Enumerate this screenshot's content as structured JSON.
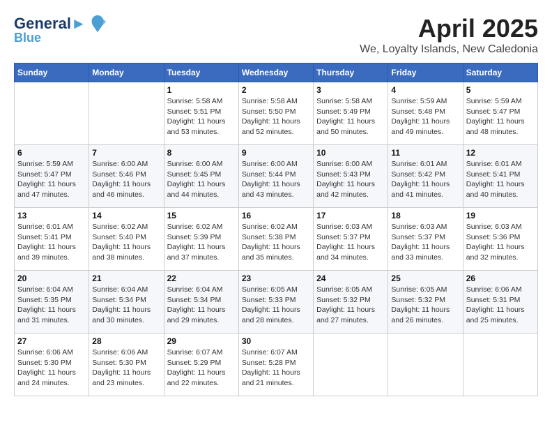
{
  "header": {
    "logo_line1": "General",
    "logo_line2": "Blue",
    "month_year": "April 2025",
    "location": "We, Loyalty Islands, New Caledonia"
  },
  "weekdays": [
    "Sunday",
    "Monday",
    "Tuesday",
    "Wednesday",
    "Thursday",
    "Friday",
    "Saturday"
  ],
  "weeks": [
    [
      {
        "day": "",
        "info": ""
      },
      {
        "day": "",
        "info": ""
      },
      {
        "day": "1",
        "info": "Sunrise: 5:58 AM\nSunset: 5:51 PM\nDaylight: 11 hours and 53 minutes."
      },
      {
        "day": "2",
        "info": "Sunrise: 5:58 AM\nSunset: 5:50 PM\nDaylight: 11 hours and 52 minutes."
      },
      {
        "day": "3",
        "info": "Sunrise: 5:58 AM\nSunset: 5:49 PM\nDaylight: 11 hours and 50 minutes."
      },
      {
        "day": "4",
        "info": "Sunrise: 5:59 AM\nSunset: 5:48 PM\nDaylight: 11 hours and 49 minutes."
      },
      {
        "day": "5",
        "info": "Sunrise: 5:59 AM\nSunset: 5:47 PM\nDaylight: 11 hours and 48 minutes."
      }
    ],
    [
      {
        "day": "6",
        "info": "Sunrise: 5:59 AM\nSunset: 5:47 PM\nDaylight: 11 hours and 47 minutes."
      },
      {
        "day": "7",
        "info": "Sunrise: 6:00 AM\nSunset: 5:46 PM\nDaylight: 11 hours and 46 minutes."
      },
      {
        "day": "8",
        "info": "Sunrise: 6:00 AM\nSunset: 5:45 PM\nDaylight: 11 hours and 44 minutes."
      },
      {
        "day": "9",
        "info": "Sunrise: 6:00 AM\nSunset: 5:44 PM\nDaylight: 11 hours and 43 minutes."
      },
      {
        "day": "10",
        "info": "Sunrise: 6:00 AM\nSunset: 5:43 PM\nDaylight: 11 hours and 42 minutes."
      },
      {
        "day": "11",
        "info": "Sunrise: 6:01 AM\nSunset: 5:42 PM\nDaylight: 11 hours and 41 minutes."
      },
      {
        "day": "12",
        "info": "Sunrise: 6:01 AM\nSunset: 5:41 PM\nDaylight: 11 hours and 40 minutes."
      }
    ],
    [
      {
        "day": "13",
        "info": "Sunrise: 6:01 AM\nSunset: 5:41 PM\nDaylight: 11 hours and 39 minutes."
      },
      {
        "day": "14",
        "info": "Sunrise: 6:02 AM\nSunset: 5:40 PM\nDaylight: 11 hours and 38 minutes."
      },
      {
        "day": "15",
        "info": "Sunrise: 6:02 AM\nSunset: 5:39 PM\nDaylight: 11 hours and 37 minutes."
      },
      {
        "day": "16",
        "info": "Sunrise: 6:02 AM\nSunset: 5:38 PM\nDaylight: 11 hours and 35 minutes."
      },
      {
        "day": "17",
        "info": "Sunrise: 6:03 AM\nSunset: 5:37 PM\nDaylight: 11 hours and 34 minutes."
      },
      {
        "day": "18",
        "info": "Sunrise: 6:03 AM\nSunset: 5:37 PM\nDaylight: 11 hours and 33 minutes."
      },
      {
        "day": "19",
        "info": "Sunrise: 6:03 AM\nSunset: 5:36 PM\nDaylight: 11 hours and 32 minutes."
      }
    ],
    [
      {
        "day": "20",
        "info": "Sunrise: 6:04 AM\nSunset: 5:35 PM\nDaylight: 11 hours and 31 minutes."
      },
      {
        "day": "21",
        "info": "Sunrise: 6:04 AM\nSunset: 5:34 PM\nDaylight: 11 hours and 30 minutes."
      },
      {
        "day": "22",
        "info": "Sunrise: 6:04 AM\nSunset: 5:34 PM\nDaylight: 11 hours and 29 minutes."
      },
      {
        "day": "23",
        "info": "Sunrise: 6:05 AM\nSunset: 5:33 PM\nDaylight: 11 hours and 28 minutes."
      },
      {
        "day": "24",
        "info": "Sunrise: 6:05 AM\nSunset: 5:32 PM\nDaylight: 11 hours and 27 minutes."
      },
      {
        "day": "25",
        "info": "Sunrise: 6:05 AM\nSunset: 5:32 PM\nDaylight: 11 hours and 26 minutes."
      },
      {
        "day": "26",
        "info": "Sunrise: 6:06 AM\nSunset: 5:31 PM\nDaylight: 11 hours and 25 minutes."
      }
    ],
    [
      {
        "day": "27",
        "info": "Sunrise: 6:06 AM\nSunset: 5:30 PM\nDaylight: 11 hours and 24 minutes."
      },
      {
        "day": "28",
        "info": "Sunrise: 6:06 AM\nSunset: 5:30 PM\nDaylight: 11 hours and 23 minutes."
      },
      {
        "day": "29",
        "info": "Sunrise: 6:07 AM\nSunset: 5:29 PM\nDaylight: 11 hours and 22 minutes."
      },
      {
        "day": "30",
        "info": "Sunrise: 6:07 AM\nSunset: 5:28 PM\nDaylight: 11 hours and 21 minutes."
      },
      {
        "day": "",
        "info": ""
      },
      {
        "day": "",
        "info": ""
      },
      {
        "day": "",
        "info": ""
      }
    ]
  ]
}
